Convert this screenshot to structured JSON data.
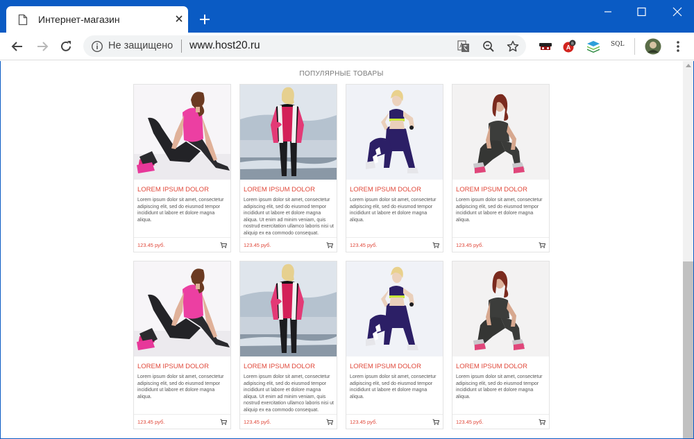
{
  "browser": {
    "tab_title": "Интернет-магазин",
    "security_text": "Не защищено",
    "url": "www.host20.ru",
    "sql_label": "SQL"
  },
  "colors": {
    "chrome_blue": "#0a5bc4",
    "accent_red": "#e0483a"
  },
  "page": {
    "section_title": "ПОПУЛЯРНЫЕ ТОВАРЫ",
    "products": [
      {
        "title": "LOREM IPSUM DOLOR",
        "desc": "Lorem ipsum dolor sit amet, consectetur adipiscing elit, sed do eiusmod tempor incididunt ut labore et dolore magna aliqua.",
        "price": "123.45 руб.",
        "image": "woman-sitting-pink-top"
      },
      {
        "title": "LOREM IPSUM DOLOR",
        "desc": "Lorem ipsum dolor sit amet, consectetur adipiscing elit, sed do eiusmod tempor incididunt ut labore et dolore magna aliqua. Ut enim ad minim veniam, quis nostrud exercitation ullamco laboris nisi ut aliquip ex ea commodo consequat.",
        "price": "123.45 руб.",
        "image": "woman-standing-vest"
      },
      {
        "title": "LOREM IPSUM DOLOR",
        "desc": "Lorem ipsum dolor sit amet, consectetur adipiscing elit, sed do eiusmod tempor incididunt ut labore et dolore magna aliqua.",
        "price": "123.45 руб.",
        "image": "woman-fitness-pose"
      },
      {
        "title": "LOREM IPSUM DOLOR",
        "desc": "Lorem ipsum dolor sit amet, consectetur adipiscing elit, sed do eiusmod tempor incididunt ut labore et dolore magna aliqua.",
        "price": "123.45 руб.",
        "image": "woman-crouching-gray"
      },
      {
        "title": "LOREM IPSUM DOLOR",
        "desc": "Lorem ipsum dolor sit amet, consectetur adipiscing elit, sed do eiusmod tempor incididunt ut labore et dolore magna aliqua.",
        "price": "123.45 руб.",
        "image": "woman-sitting-pink-top"
      },
      {
        "title": "LOREM IPSUM DOLOR",
        "desc": "Lorem ipsum dolor sit amet, consectetur adipiscing elit, sed do eiusmod tempor incididunt ut labore et dolore magna aliqua. Ut enim ad minim veniam, quis nostrud exercitation ullamco laboris nisi ut aliquip ex ea commodo consequat.",
        "price": "123.45 руб.",
        "image": "woman-standing-vest"
      },
      {
        "title": "LOREM IPSUM DOLOR",
        "desc": "Lorem ipsum dolor sit amet, consectetur adipiscing elit, sed do eiusmod tempor incididunt ut labore et dolore magna aliqua.",
        "price": "123.45 руб.",
        "image": "woman-fitness-pose"
      },
      {
        "title": "LOREM IPSUM DOLOR",
        "desc": "Lorem ipsum dolor sit amet, consectetur adipiscing elit, sed do eiusmod tempor incididunt ut labore et dolore magna aliqua.",
        "price": "123.45 руб.",
        "image": "woman-crouching-gray"
      }
    ]
  }
}
